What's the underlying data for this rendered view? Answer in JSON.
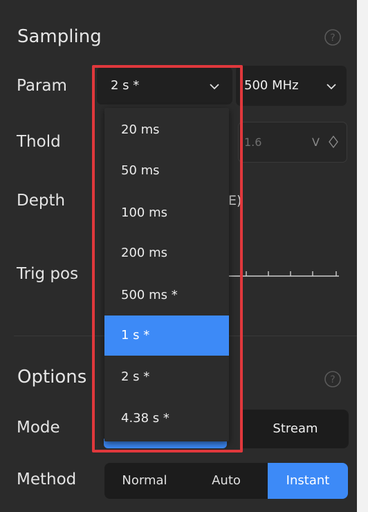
{
  "sampling": {
    "title": "Sampling",
    "param_label": "Param",
    "param_value": "2 s *",
    "freq_value": "500 MHz",
    "thold_label": "Thold",
    "thold_value": "1.6",
    "thold_unit": "V",
    "depth_label": "Depth",
    "depth_fragment": "E)",
    "trig_label": "Trig pos"
  },
  "options": {
    "title": "Options",
    "mode_label": "Mode",
    "mode_stream": "Stream",
    "method_label": "Method",
    "method_items": [
      "Normal",
      "Auto",
      "Instant"
    ],
    "method_selected": "Instant"
  },
  "dropdown": {
    "items": [
      "20 ms",
      "50 ms",
      "100 ms",
      "200 ms",
      "500 ms *",
      "1 s *",
      "2 s *",
      "4.38 s *"
    ],
    "highlighted": "1 s *"
  },
  "colors": {
    "accent": "#3d8af7",
    "annotation_box": "#e0383c",
    "panel_bg": "#2b2b2b"
  },
  "icons": {
    "help": "help-circle-icon",
    "dropdown": "chevron-down-icon",
    "spin": "spin-arrows-icon"
  }
}
